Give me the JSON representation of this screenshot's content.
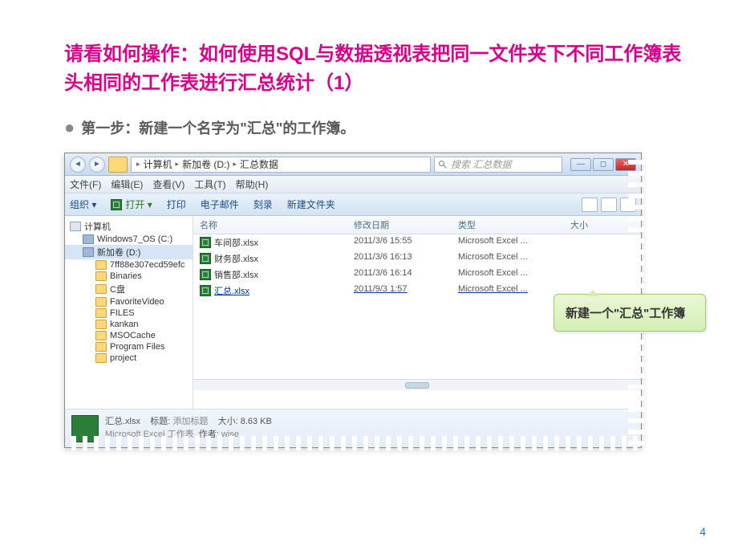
{
  "slide": {
    "title": "请看如何操作：如何使用SQL与数据透视表把同一文件夹下不同工作簿表头相同的工作表进行汇总统计（1）",
    "step": "第一步：新建一个名字为\"汇总\"的工作簿。",
    "pageNum": "4"
  },
  "win": {
    "breadcrumb": {
      "c1": "计算机",
      "c2": "新加卷 (D:)",
      "c3": "汇总数据"
    },
    "search_placeholder": "搜索 汇总数据",
    "menus": {
      "file": "文件(F)",
      "edit": "编辑(E)",
      "view": "查看(V)",
      "tools": "工具(T)",
      "help": "帮助(H)"
    },
    "toolbar": {
      "org": "组织 ▾",
      "open": "打开 ▾",
      "print": "打印",
      "email": "电子邮件",
      "burn": "刻录",
      "newfolder": "新建文件夹"
    },
    "tree": {
      "computer": "计算机",
      "c_drive": "Windows7_OS (C:)",
      "d_drive": "新加卷 (D:)",
      "items": [
        "7ff88e307ecd59efc",
        "Binaries",
        "C盘",
        "FavoriteVideo",
        "FILES",
        "kankan",
        "MSOCache",
        "Program Files",
        "project"
      ]
    },
    "cols": {
      "name": "名称",
      "date": "修改日期",
      "type": "类型",
      "size": "大小"
    },
    "files": [
      {
        "name": "车间部.xlsx",
        "date": "2011/3/6 15:55",
        "type": "Microsoft Excel ..."
      },
      {
        "name": "财务部.xlsx",
        "date": "2011/3/6 16:13",
        "type": "Microsoft Excel ..."
      },
      {
        "name": "销售部.xlsx",
        "date": "2011/3/6 16:14",
        "type": "Microsoft Excel ..."
      },
      {
        "name": "汇总.xlsx",
        "date": "2011/9/3 1:57",
        "type": "Microsoft Excel ..."
      }
    ],
    "details": {
      "name": "汇总.xlsx",
      "type": "Microsoft Excel 工作表",
      "title_lbl": "标题:",
      "title_val": "添加标题",
      "author_lbl": "作者:",
      "author_val": "wise",
      "size_lbl": "大小:",
      "size_val": "8.63 KB"
    }
  },
  "callout": "新建一个\"汇总\"工作簿"
}
